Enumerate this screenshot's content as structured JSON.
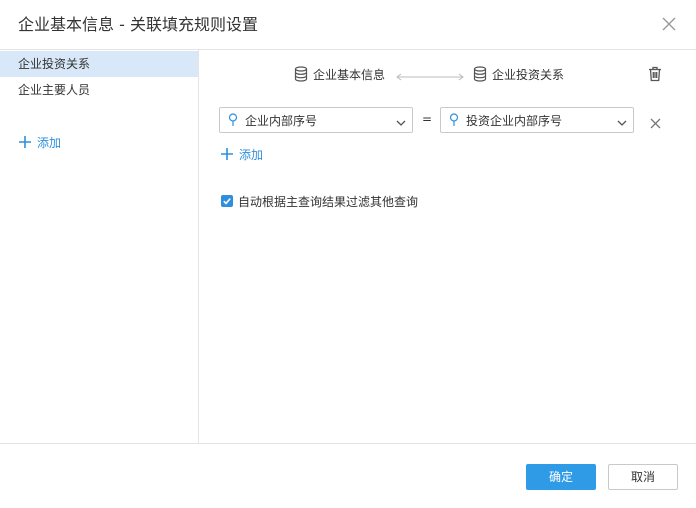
{
  "dialog": {
    "title": "企业基本信息 - 关联填充规则设置"
  },
  "sidebar": {
    "items": [
      {
        "label": "企业投资关系",
        "active": true
      },
      {
        "label": "企业主要人员",
        "active": false
      }
    ],
    "add_label": "添加"
  },
  "relation": {
    "source_table": "企业基本信息",
    "target_table": "企业投资关系",
    "mapping": {
      "left_field": "企业内部序号",
      "operator": "=",
      "right_field": "投资企业内部序号"
    },
    "add_label": "添加",
    "filter_option": {
      "checked": true,
      "label": "自动根据主查询结果过滤其他查询"
    }
  },
  "footer": {
    "ok_label": "确定",
    "cancel_label": "取消"
  },
  "colors": {
    "accent": "#2f8fdd",
    "primary_button": "#2f9be6",
    "selected_row": "#d9e8f8"
  }
}
